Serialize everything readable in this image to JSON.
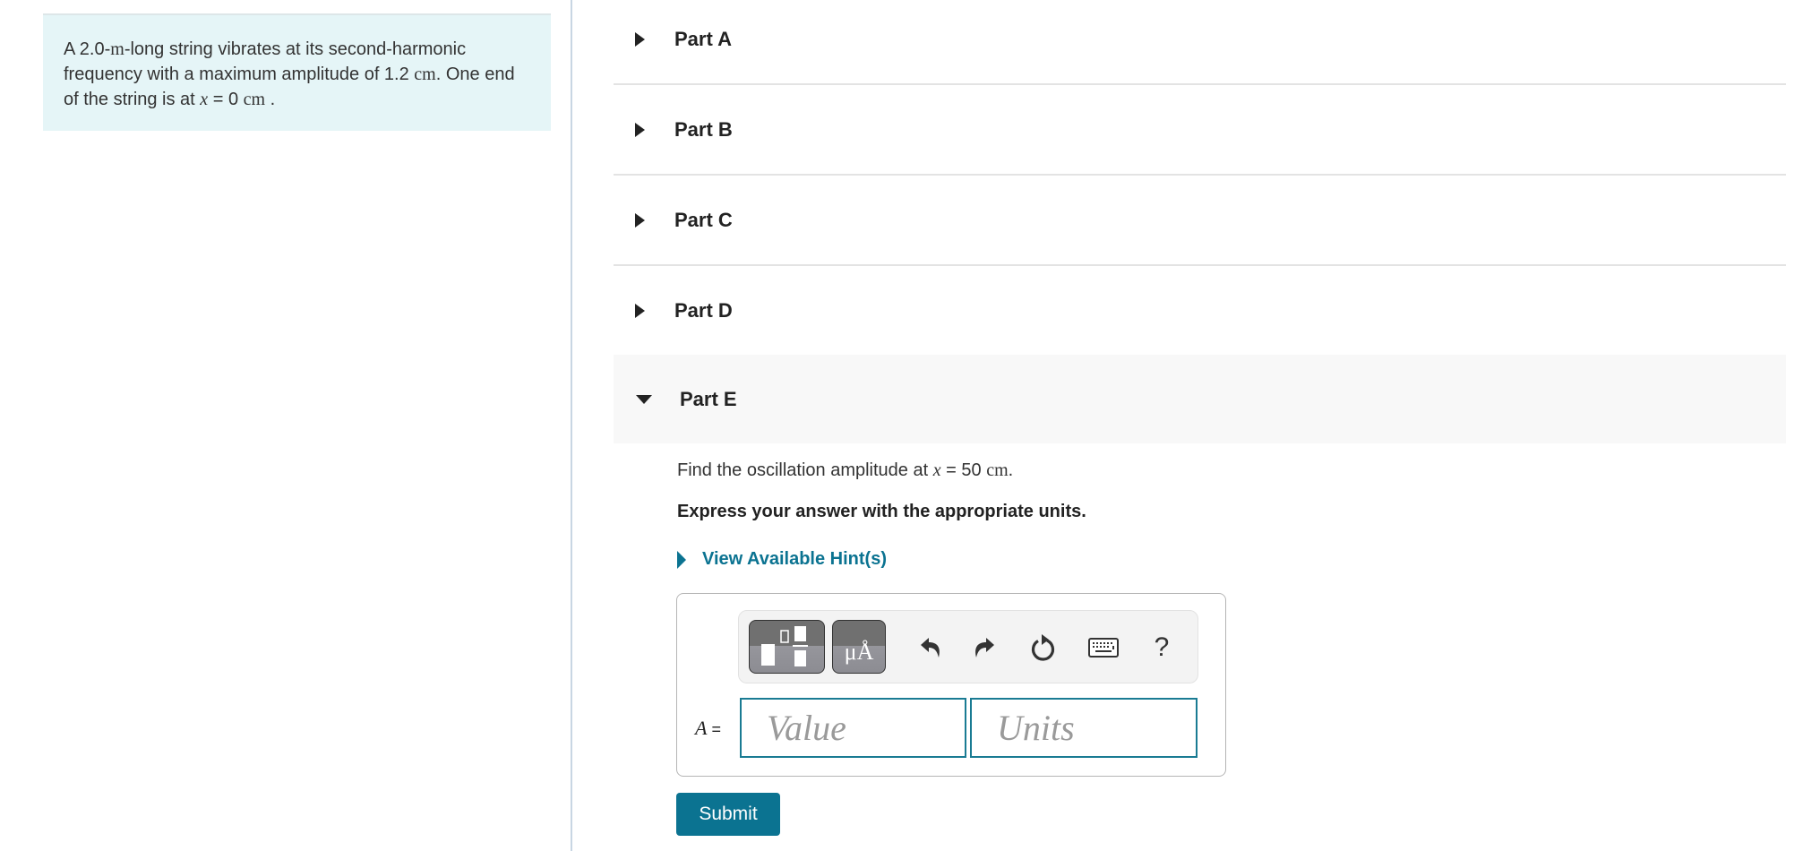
{
  "problem": {
    "segments": [
      {
        "t": "A 2.0-",
        "style": "text"
      },
      {
        "t": "m",
        "style": "math"
      },
      {
        "t": "-long string vibrates at its second-harmonic frequency with a maximum amplitude of 1.2 ",
        "style": "text"
      },
      {
        "t": "cm",
        "style": "math"
      },
      {
        "t": ". One end of the string is at ",
        "style": "text"
      },
      {
        "t": "x",
        "style": "mathit"
      },
      {
        "t": " = 0 ",
        "style": "text"
      },
      {
        "t": "cm",
        "style": "math"
      },
      {
        "t": " .",
        "style": "text"
      }
    ]
  },
  "parts": [
    {
      "label": "Part A",
      "expanded": false
    },
    {
      "label": "Part B",
      "expanded": false
    },
    {
      "label": "Part C",
      "expanded": false
    },
    {
      "label": "Part D",
      "expanded": false
    },
    {
      "label": "Part E",
      "expanded": true
    }
  ],
  "part_e": {
    "question_prefix": "Find the oscillation amplitude at ",
    "question_var": "x",
    "question_eq": " = 50 ",
    "question_unit": "cm",
    "question_suffix": ".",
    "instruction": "Express your answer with the appropriate units.",
    "hint_link": "View Available Hint(s)",
    "toolbar": {
      "buttons": [
        {
          "name": "templates",
          "icon": "templates-icon"
        },
        {
          "name": "units",
          "icon": "units-icon",
          "glyph": "μÅ"
        },
        {
          "name": "undo",
          "icon": "undo-icon"
        },
        {
          "name": "redo",
          "icon": "redo-icon"
        },
        {
          "name": "reset",
          "icon": "reset-icon"
        },
        {
          "name": "keyboard",
          "icon": "keyboard-icon"
        },
        {
          "name": "help",
          "icon": "help-icon",
          "glyph": "?"
        }
      ]
    },
    "variable": "A",
    "equals": " =",
    "value_placeholder": "Value",
    "value": "",
    "units_placeholder": "Units",
    "units": "",
    "submit_label": "Submit"
  },
  "colors": {
    "accent": "#0b7391",
    "intro_bg": "#e5f5f7",
    "active_part_bg": "#f8f8f8"
  }
}
